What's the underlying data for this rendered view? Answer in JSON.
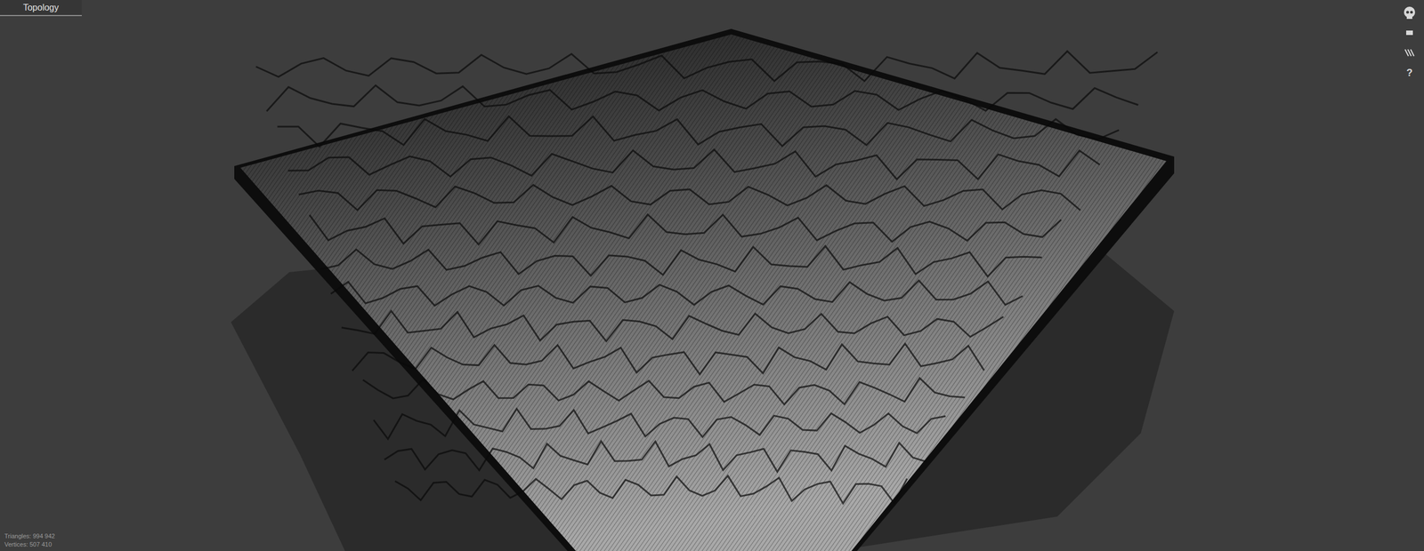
{
  "tabs": [
    {
      "label": "Topology",
      "selected": true
    }
  ],
  "toolbar": [
    {
      "name": "skull",
      "label": ""
    },
    {
      "name": "panel",
      "label": ""
    },
    {
      "name": "stripes",
      "label": ""
    },
    {
      "name": "help",
      "label": "?"
    }
  ],
  "stats": [
    {
      "label": "Triangles: 994 942"
    },
    {
      "label": "Vertices: 507 410"
    }
  ]
}
